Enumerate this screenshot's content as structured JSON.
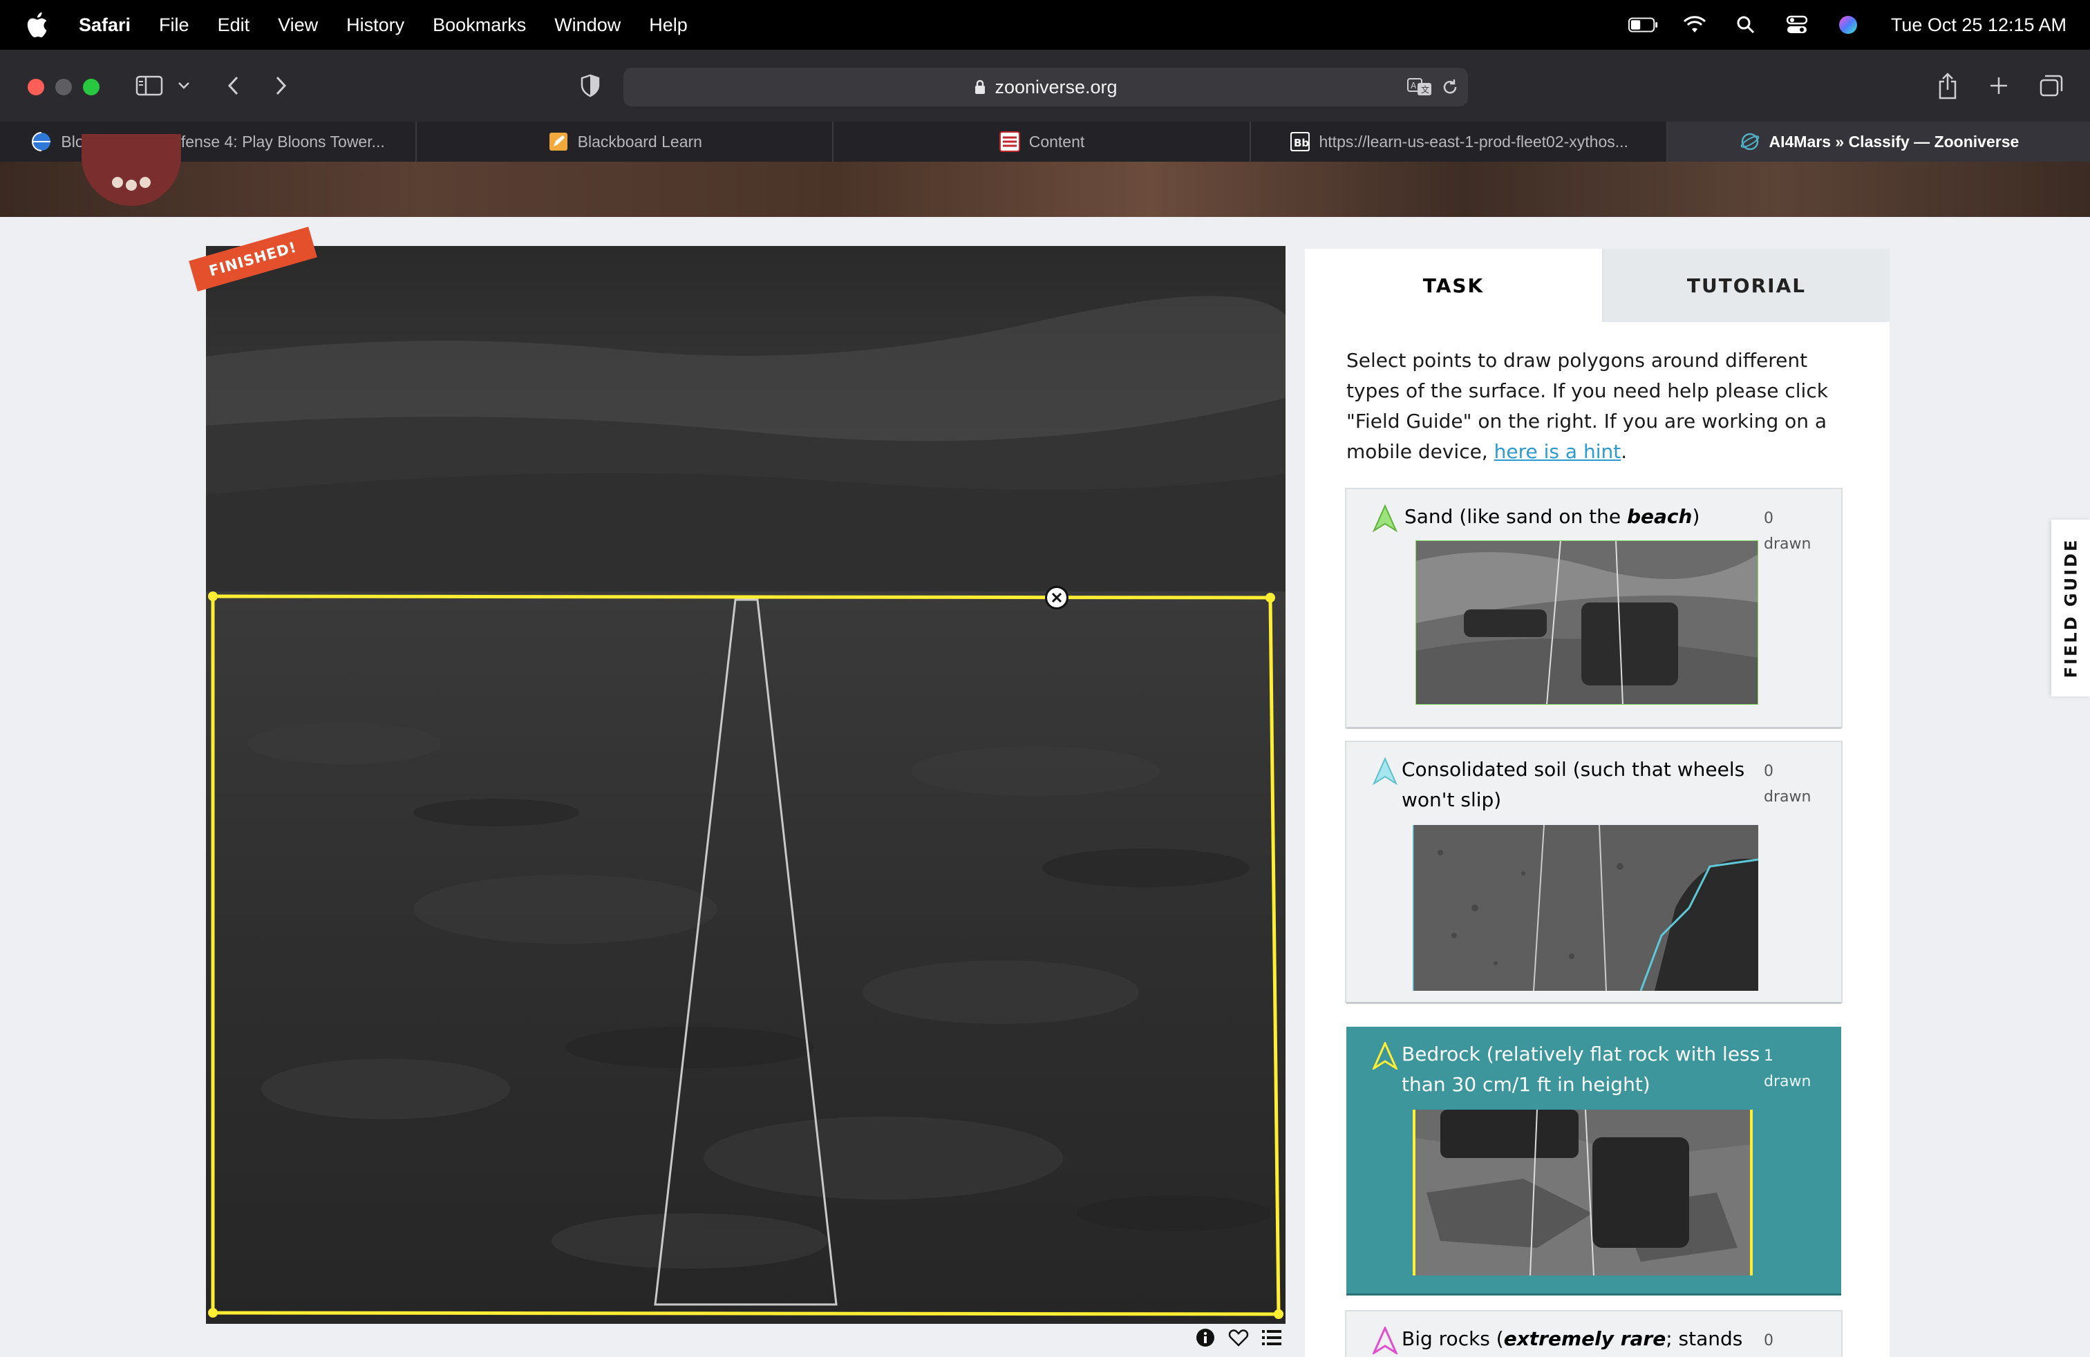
{
  "menubar": {
    "app": "Safari",
    "items": [
      "File",
      "Edit",
      "View",
      "History",
      "Bookmarks",
      "Window",
      "Help"
    ],
    "clock": "Tue Oct 25  12:15 AM"
  },
  "browser": {
    "url": "zooniverse.org",
    "tabs": [
      {
        "label": "Bloons Tower Defense 4: Play Bloons Tower...",
        "icon": "globe-icon"
      },
      {
        "label": "Blackboard Learn",
        "icon": "pencil-icon"
      },
      {
        "label": "Content",
        "icon": "content-icon"
      },
      {
        "label": "https://learn-us-east-1-prod-fleet02-xythos...",
        "icon": "blackboard-icon"
      },
      {
        "label": "AI4Mars » Classify — Zooniverse",
        "icon": "zooniverse-icon"
      }
    ]
  },
  "subject": {
    "badge": "FINISHED!"
  },
  "panel": {
    "tabs": {
      "task": "TASK",
      "tutorial": "TUTORIAL"
    },
    "instructions": {
      "before": "Select points to draw polygons around different types of the surface. If you need help please click \"Field Guide\" on the right. If you are working on a mobile device, ",
      "link": "here is a hint",
      "after": "."
    },
    "tools": [
      {
        "pre": "Sand (like sand on the ",
        "em": "beach",
        "post": ")",
        "count": "0",
        "drawn": "drawn",
        "color": "#7ed957"
      },
      {
        "pre": "Consolidated soil (such that wheels won't slip)",
        "em": "",
        "post": "",
        "count": "0",
        "drawn": "drawn",
        "color": "#7fd6e0"
      },
      {
        "pre": "Bedrock (relatively flat rock with less than 30 cm/1 ft in height)",
        "em": "",
        "post": "",
        "count": "1",
        "drawn": "drawn",
        "color": "#f5e64a"
      },
      {
        "pre": "Big rocks (",
        "em": "extremely rare",
        "post": "; stands",
        "count": "0",
        "drawn": "",
        "color": "#e04fd0"
      }
    ]
  },
  "field_guide": "FIELD GUIDE",
  "colors": {
    "accent": "#3c969c",
    "polygon": "#ffee33",
    "badge": "#e4502c",
    "link": "#2b9bd1"
  }
}
